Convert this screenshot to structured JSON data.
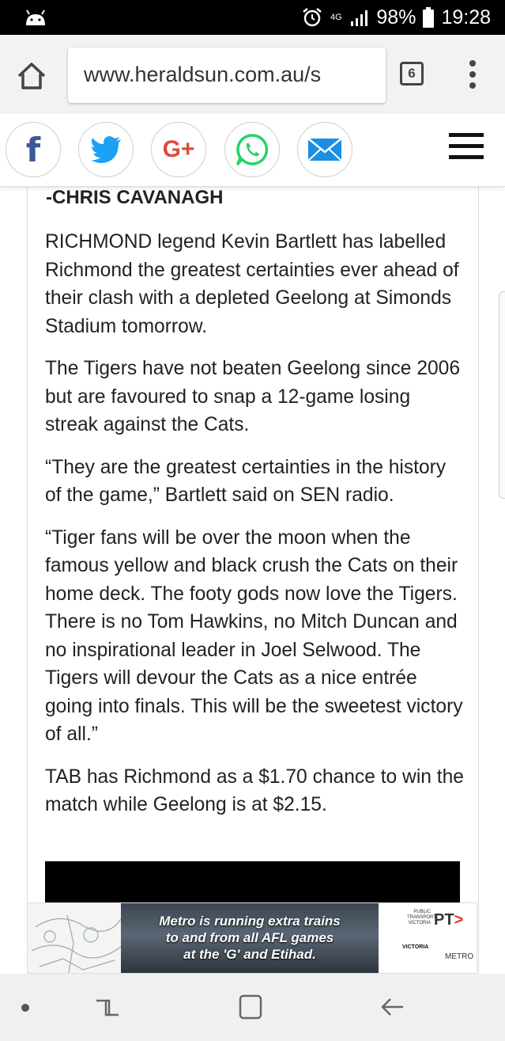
{
  "status_bar": {
    "network": "4G",
    "battery": "98%",
    "time": "19:28",
    "icons": [
      "android-icon",
      "alarm-icon",
      "signal-icon",
      "battery-icon"
    ]
  },
  "browser": {
    "url": "www.heraldsun.com.au/s",
    "tab_count": "6",
    "icons": [
      "home-icon",
      "more-vert-icon"
    ]
  },
  "share_bar": {
    "facebook_label": "f",
    "google_label": "G+",
    "icons": [
      "facebook-icon",
      "twitter-icon",
      "google-plus-icon",
      "whatsapp-icon",
      "email-icon",
      "hamburger-menu-icon"
    ]
  },
  "article": {
    "byline": "-CHRIS CAVANAGH",
    "paragraphs": [
      "RICHMOND legend Kevin Bartlett has labelled Richmond the greatest certainties ever ahead of their clash with a depleted Geelong at Simonds Stadium tomorrow.",
      "The Tigers have not beaten Geelong since 2006 but are favoured to snap a 12-game losing streak against the Cats.",
      "“They are the greatest certainties in the history of the game,” Bartlett said on SEN radio.",
      "“Tiger fans will be over the moon when the famous yellow and black crush the Cats on their home deck. The footy gods now love the Tigers. There is no Tom Hawkins, no Mitch Duncan and no inspirational leader in Joel Selwood. The Tigers will devour the Cats as a nice entrée going into finals. This will be the sweetest victory of all.”",
      "TAB has Richmond as a $1.70 chance to win the match while Geelong is at $2.15."
    ]
  },
  "ad": {
    "lines": [
      "Metro is running extra trains",
      "to and from all AFL games",
      "at the 'G' and Etihad."
    ],
    "ptv_small": "PUBLIC TRANSPORT VICTORIA",
    "ptv_logo": "PT",
    "vic_logo": "VICTORIA",
    "metro_logo": "METRO"
  },
  "nav_bar": {
    "icons": [
      "dot-icon",
      "recents-icon",
      "home-square-icon",
      "back-icon"
    ]
  },
  "colors": {
    "facebook": "#3b5998",
    "twitter": "#1da1f2",
    "google": "#dd4b39",
    "whatsapp": "#25d366",
    "email": "#1a8fe3"
  }
}
